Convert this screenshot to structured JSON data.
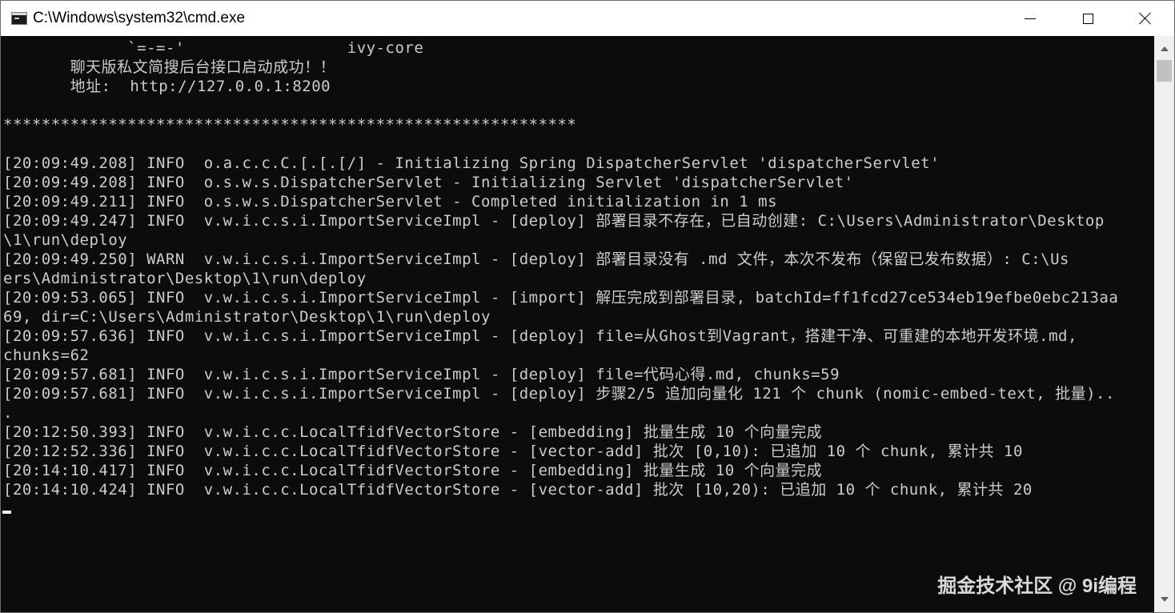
{
  "window": {
    "title": "C:\\Windows\\system32\\cmd.exe",
    "controls": {
      "minimize": "minimize",
      "maximize": "maximize",
      "close": "close"
    }
  },
  "console": {
    "lines": [
      "             `=-=-'                 ivy-core",
      "       聊天版私文简搜后台接口启动成功！！",
      "       地址:  http://127.0.0.1:8200",
      "",
      "************************************************************",
      "",
      "[20:09:49.208] INFO  o.a.c.c.C.[.[.[/] - Initializing Spring DispatcherServlet 'dispatcherServlet'",
      "[20:09:49.208] INFO  o.s.w.s.DispatcherServlet - Initializing Servlet 'dispatcherServlet'",
      "[20:09:49.211] INFO  o.s.w.s.DispatcherServlet - Completed initialization in 1 ms",
      "[20:09:49.247] INFO  v.w.i.c.s.i.ImportServiceImpl - [deploy] 部署目录不存在，已自动创建: C:\\Users\\Administrator\\Desktop",
      "\\1\\run\\deploy",
      "[20:09:49.250] WARN  v.w.i.c.s.i.ImportServiceImpl - [deploy] 部署目录没有 .md 文件，本次不发布（保留已发布数据）: C:\\Us",
      "ers\\Administrator\\Desktop\\1\\run\\deploy",
      "[20:09:53.065] INFO  v.w.i.c.s.i.ImportServiceImpl - [import] 解压完成到部署目录, batchId=ff1fcd27ce534eb19efbe0ebc213aa",
      "69, dir=C:\\Users\\Administrator\\Desktop\\1\\run\\deploy",
      "[20:09:57.636] INFO  v.w.i.c.s.i.ImportServiceImpl - [deploy] file=从Ghost到Vagrant，搭建干净、可重建的本地开发环境.md,",
      "chunks=62",
      "[20:09:57.681] INFO  v.w.i.c.s.i.ImportServiceImpl - [deploy] file=代码心得.md, chunks=59",
      "[20:09:57.681] INFO  v.w.i.c.s.i.ImportServiceImpl - [deploy] 步骤2/5 追加向量化 121 个 chunk (nomic-embed-text, 批量)..",
      ".",
      "[20:12:50.393] INFO  v.w.i.c.c.LocalTfidfVectorStore - [embedding] 批量生成 10 个向量完成",
      "[20:12:52.336] INFO  v.w.i.c.c.LocalTfidfVectorStore - [vector-add] 批次 [0,10): 已追加 10 个 chunk, 累计共 10",
      "[20:14:10.417] INFO  v.w.i.c.c.LocalTfidfVectorStore - [embedding] 批量生成 10 个向量完成",
      "[20:14:10.424] INFO  v.w.i.c.c.LocalTfidfVectorStore - [vector-add] 批次 [10,20): 已追加 10 个 chunk, 累计共 20"
    ]
  },
  "watermark": "掘金技术社区 @ 9i编程",
  "icons": {
    "app": "cmd-icon",
    "scroll_up": "chevron-up-icon",
    "scroll_down": "chevron-down-icon"
  },
  "colors": {
    "console_bg": "#0c0c0c",
    "console_fg": "#cccccc",
    "titlebar_bg": "#ffffff"
  }
}
